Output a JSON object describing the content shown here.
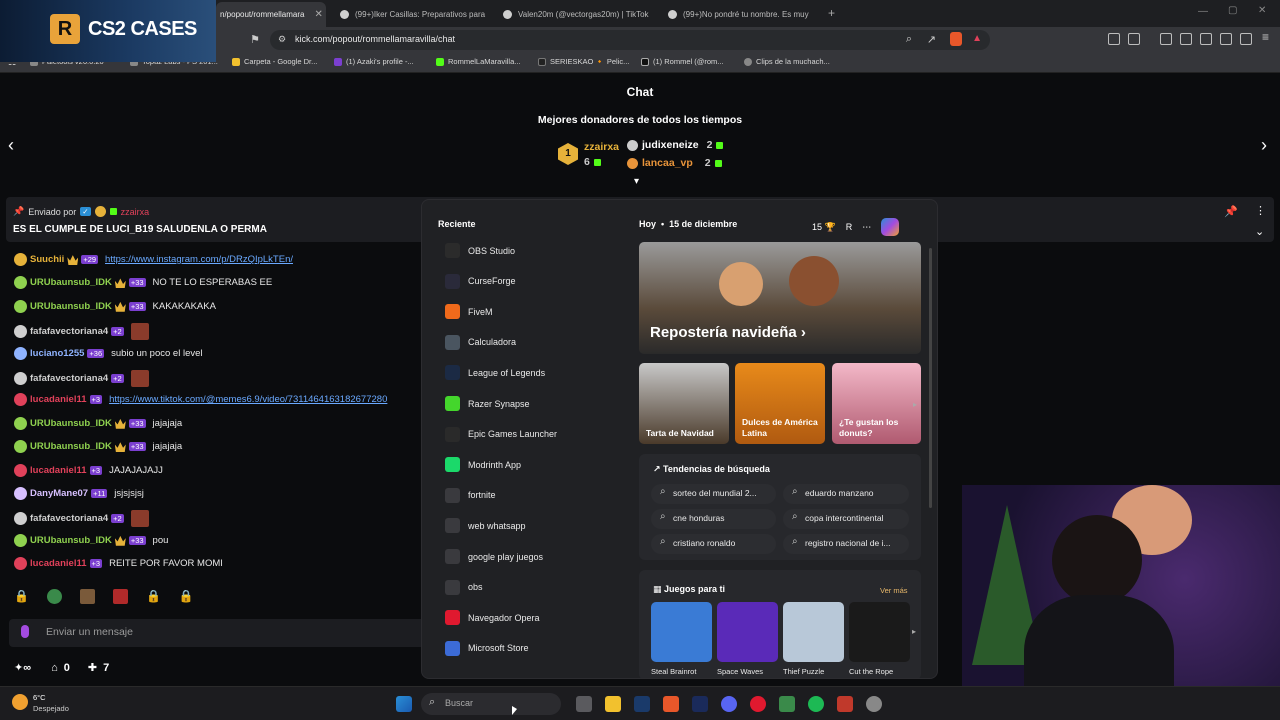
{
  "browser": {
    "tabs": [
      {
        "label": "n/popout/rommellamara"
      },
      {
        "label": "(99+)Iker Casillas: Preparativos para"
      },
      {
        "label": "Valen20m (@vectorgas20m) | TikTok"
      },
      {
        "label": "(99+)No pondré tu nombre. Es muy"
      }
    ],
    "url": "kick.com/popout/rommellamaravilla/chat",
    "bookmarks": [
      "Paletools v26.0.20",
      "Topaz Labs - PS 201...",
      "Carpeta - Google Dr...",
      "(1) Azaki's profile -...",
      "RommelLaMaravilla...",
      "SERIESKAO 🔸 Pelic...",
      "(1) Rommel (@rom...",
      "Clips de la muchach..."
    ]
  },
  "promo": {
    "logo": "R",
    "text": "CS2 CASES"
  },
  "chat": {
    "title": "Chat",
    "donors_title": "Mejores donadores de todos los tiempos",
    "donors": [
      {
        "rank": "1",
        "name": "zzairxa",
        "count": "6",
        "color": "#e6b23a"
      },
      {
        "rank": "2",
        "name": "judixeneize",
        "count": "2",
        "color": "#ffffff"
      },
      {
        "rank": "3",
        "name": "lancaa_vp",
        "count": "2",
        "color": "#e8943a"
      }
    ],
    "pinned": {
      "prefix": "Enviado por",
      "user": "zzairxa",
      "text": "ES EL CUMPLE DE LUCI_B19 SALUDENLA O PERMA"
    },
    "messages": [
      {
        "user": "Suuchii",
        "color": "#e6b23a",
        "badge": "+29",
        "text": "https://www.instagram.com/p/DRzQIpLkTEn/",
        "link": true
      },
      {
        "user": "URUbaunsub_IDK",
        "color": "#8fd14f",
        "badge": "+33",
        "text": "NO TE LO ESPERABAS EE",
        "link": false
      },
      {
        "user": "URUbaunsub_IDK",
        "color": "#8fd14f",
        "badge": "+33",
        "text": "KAKAKAKAKA",
        "link": false
      },
      {
        "user": "fafafavectoriana4",
        "color": "#cfcfcf",
        "badge": "+2",
        "text": "",
        "link": false
      },
      {
        "user": "luciano1255",
        "color": "#8fb3ff",
        "badge": "+36",
        "text": "subio un poco el level",
        "link": false
      },
      {
        "user": "fafafavectoriana4",
        "color": "#cfcfcf",
        "badge": "+2",
        "text": "",
        "link": false
      },
      {
        "user": "lucadaniel11",
        "color": "#e0415a",
        "badge": "+3",
        "text": "https://www.tiktok.com/@memes6.9/video/7311464163182677280",
        "link": true
      },
      {
        "user": "URUbaunsub_IDK",
        "color": "#8fd14f",
        "badge": "+33",
        "text": "jajajaja",
        "link": false
      },
      {
        "user": "URUbaunsub_IDK",
        "color": "#8fd14f",
        "badge": "+33",
        "text": "jajajaja",
        "link": false
      },
      {
        "user": "lucadaniel11",
        "color": "#e0415a",
        "badge": "+3",
        "text": "JAJAJAJAJJ",
        "link": false
      },
      {
        "user": "DanyMane07",
        "color": "#d7c0ff",
        "badge": "+11",
        "text": "jsjsjsjsj",
        "link": false
      },
      {
        "user": "fafafavectoriana4",
        "color": "#cfcfcf",
        "badge": "+2",
        "text": "",
        "link": false
      },
      {
        "user": "URUbaunsub_IDK",
        "color": "#8fd14f",
        "badge": "+33",
        "text": "pou",
        "link": false
      },
      {
        "user": "lucadaniel11",
        "color": "#e0415a",
        "badge": "+3",
        "text": "REITE POR FAVOR MOMI",
        "link": false
      }
    ],
    "compose_placeholder": "Enviar un mensaje",
    "viewers_left": "0",
    "viewers_right": "7"
  },
  "start_menu": {
    "recent_title": "Reciente",
    "apps": [
      {
        "label": "OBS Studio",
        "color": "#2b2b2b"
      },
      {
        "label": "CurseForge",
        "color": "#2a2a3a"
      },
      {
        "label": "FiveM",
        "color": "#f06a1b"
      },
      {
        "label": "Calculadora",
        "color": "#4a5560"
      },
      {
        "label": "League of Legends",
        "color": "#1b2a44"
      },
      {
        "label": "Razer Synapse",
        "color": "#44d62c"
      },
      {
        "label": "Epic Games Launcher",
        "color": "#2a2a2a"
      },
      {
        "label": "Modrinth App",
        "color": "#1bd96a"
      },
      {
        "label": "fortnite",
        "color": "#3a3a3e"
      },
      {
        "label": "web whatsapp",
        "color": "#3a3a3e"
      },
      {
        "label": "google play juegos",
        "color": "#3a3a3e"
      },
      {
        "label": "obs",
        "color": "#3a3a3e"
      },
      {
        "label": "Navegador Opera",
        "color": "#e0192f"
      },
      {
        "label": "Microsoft Store",
        "color": "#3c6bd6"
      }
    ],
    "date_today": "Hoy",
    "date": "15 de diciembre",
    "points": "15",
    "avatar_letter": "R",
    "hero": "Repostería navideña",
    "tiles": [
      "Tarta de Navidad",
      "Dulces de América Latina",
      "¿Te gustan los donuts?"
    ],
    "trends_title": "Tendencias de búsqueda",
    "trends": [
      "sorteo del mundial 2...",
      "eduardo manzano",
      "cne honduras",
      "copa intercontinental",
      "cristiano ronaldo",
      "registro nacional de i..."
    ],
    "games_title": "Juegos para ti",
    "games_more": "Ver más",
    "games": [
      {
        "label": "Steal Brainrot",
        "color": "#3a7bd5"
      },
      {
        "label": "Space Waves",
        "color": "#5a2ab8"
      },
      {
        "label": "Thief Puzzle",
        "color": "#b8c8d8"
      },
      {
        "label": "Cut the Rope",
        "color": "#1a1a1a"
      }
    ]
  },
  "taskbar": {
    "weather_temp": "6°C",
    "weather_text": "Despejado",
    "search_placeholder": "Buscar"
  }
}
